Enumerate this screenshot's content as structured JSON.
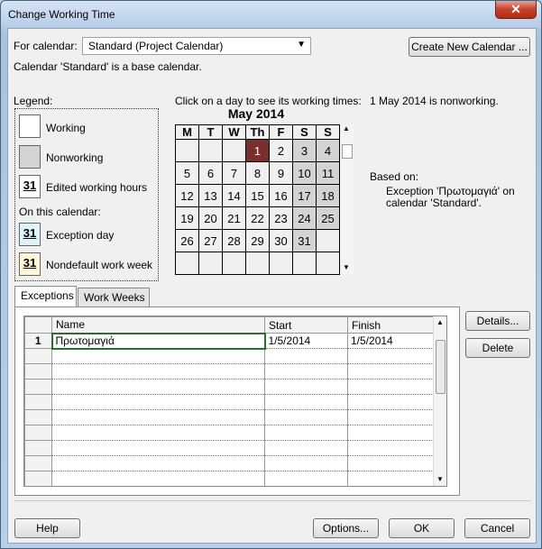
{
  "window": {
    "title": "Change Working Time",
    "close_glyph": "✕"
  },
  "for_calendar": {
    "label": "For calendar:",
    "value": "Standard (Project Calendar)",
    "create_button": "Create New Calendar ..."
  },
  "base_note": "Calendar 'Standard' is a base calendar.",
  "legend": {
    "title": "Legend:",
    "working": "Working",
    "nonworking": "Nonworking",
    "edited": "Edited working hours",
    "on_this_calendar": "On this calendar:",
    "exception": "Exception day",
    "nondefault": "Nondefault work week",
    "swatch_number": "31"
  },
  "calendar": {
    "instruction": "Click on a day to see its working times:",
    "month": "May 2014",
    "weekdays": [
      "M",
      "T",
      "W",
      "Th",
      "F",
      "S",
      "S"
    ],
    "weeks": [
      [
        "",
        "",
        "",
        "1",
        "2",
        "3",
        "4"
      ],
      [
        "5",
        "6",
        "7",
        "8",
        "9",
        "10",
        "11"
      ],
      [
        "12",
        "13",
        "14",
        "15",
        "16",
        "17",
        "18"
      ],
      [
        "19",
        "20",
        "21",
        "22",
        "23",
        "24",
        "25"
      ],
      [
        "26",
        "27",
        "28",
        "29",
        "30",
        "31",
        ""
      ],
      [
        "",
        "",
        "",
        "",
        "",
        "",
        ""
      ]
    ]
  },
  "info": {
    "status": "1 May 2014 is nonworking.",
    "based_on": "Based on:",
    "detail_line1": "Exception 'Πρωτομαγιά' on",
    "detail_line2": "calendar 'Standard'."
  },
  "tabs": [
    {
      "label": "Exceptions"
    },
    {
      "label": "Work Weeks"
    }
  ],
  "exceptions_table": {
    "columns": [
      "Name",
      "Start",
      "Finish"
    ],
    "rows": [
      {
        "index": "1",
        "name": "Πρωτομαγιά",
        "start": "1/5/2014",
        "finish": "1/5/2014"
      }
    ]
  },
  "side_buttons": {
    "details": "Details...",
    "delete": "Delete"
  },
  "footer": {
    "help": "Help",
    "options": "Options...",
    "ok": "OK",
    "cancel": "Cancel"
  },
  "colors": {
    "exception_day": "#7a2f2f",
    "nonworking": "#d3d3d3",
    "selection_border": "#2c6e2c"
  }
}
